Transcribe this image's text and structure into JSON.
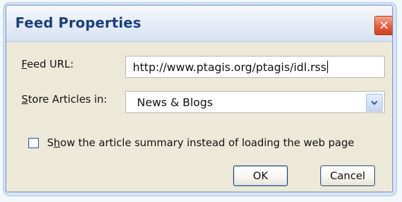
{
  "window": {
    "title": "Feed Properties",
    "close_glyph": "✕",
    "title_color": "#1b3f7a",
    "close_color": "#e45f3d"
  },
  "form": {
    "feed_url": {
      "label_mnemonic": "F",
      "label_rest": "eed URL:",
      "value": "http://www.ptagis.org/ptagis/idl.rss"
    },
    "store_in": {
      "label_mnemonic": "S",
      "label_rest": "tore Articles in:",
      "selected": "News & Blogs"
    },
    "show_summary": {
      "label_start": "S",
      "label_mnemonic": "h",
      "label_rest": "ow the article summary instead of loading the web page",
      "checked": false
    }
  },
  "buttons": {
    "ok": "OK",
    "cancel": "Cancel"
  },
  "icons": {
    "close": "close-icon",
    "dropdown": "chevron-down-icon",
    "checkbox": "checkbox-icon"
  }
}
